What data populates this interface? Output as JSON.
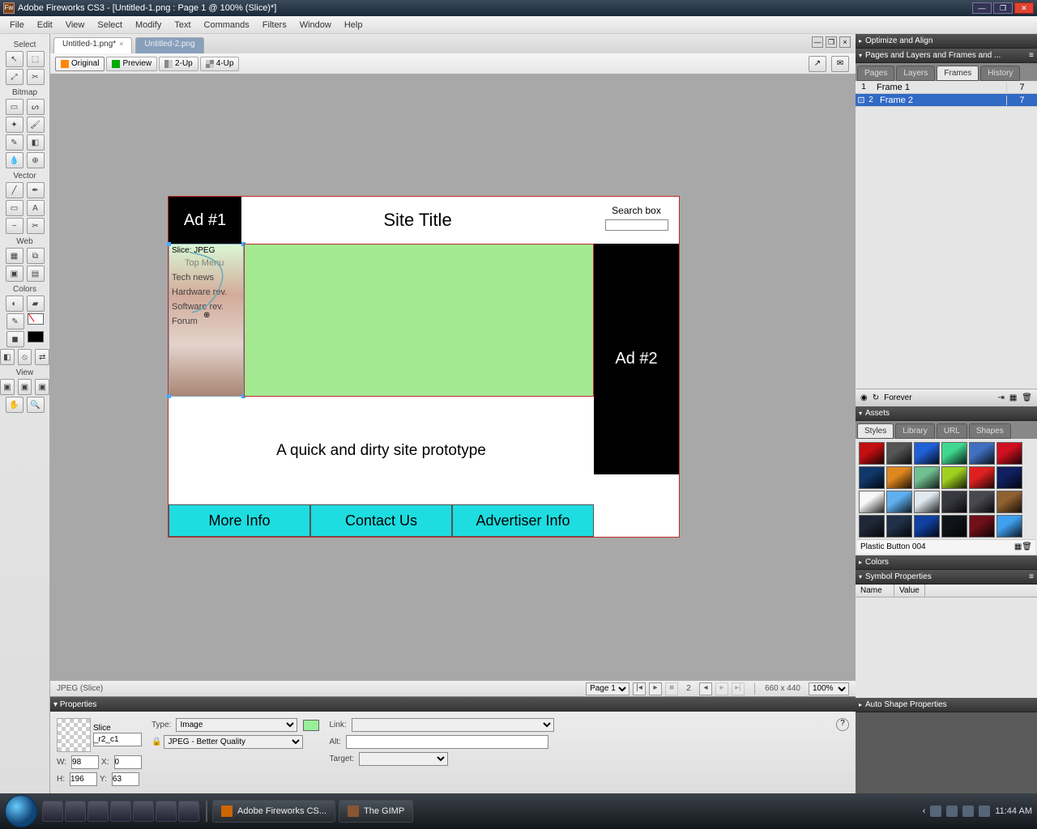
{
  "title": "Adobe Fireworks CS3 - [Untitled-1.png : Page 1 @ 100% (Slice)*]",
  "menu": [
    "File",
    "Edit",
    "View",
    "Select",
    "Modify",
    "Text",
    "Commands",
    "Filters",
    "Window",
    "Help"
  ],
  "toolbox": {
    "select": "Select",
    "bitmap": "Bitmap",
    "vector": "Vector",
    "web": "Web",
    "colors": "Colors",
    "view": "View"
  },
  "tabs": {
    "active": "Untitled-1.png*",
    "inactive": "Untitled-2.png"
  },
  "viewbar": {
    "original": "Original",
    "preview": "Preview",
    "two_up": "2-Up",
    "four_up": "4-Up"
  },
  "prototype": {
    "ad1": "Ad #1",
    "site_title": "Site Title",
    "search_label": "Search box",
    "slice_label": "Slice: JPEG",
    "top_menu": "Top Menu",
    "items": [
      "Tech news",
      "Hardware rev.",
      "Software rev.",
      "Forum"
    ],
    "ad2": "Ad #2",
    "body_text": "A quick and dirty site prototype",
    "footer": [
      "More Info",
      "Contact Us",
      "Advertiser Info"
    ]
  },
  "status": {
    "left": "JPEG (Slice)",
    "page": "Page 1",
    "frame_num": "2",
    "dims": "660 x 440",
    "zoom": "100%"
  },
  "panels": {
    "optimize": "Optimize and Align",
    "pages_layers": "Pages and Layers and Frames and ...",
    "tabs": [
      "Pages",
      "Layers",
      "Frames",
      "History"
    ],
    "frames": [
      {
        "num": "1",
        "name": "Frame 1",
        "dur": "7"
      },
      {
        "num": "2",
        "name": "Frame 2",
        "dur": "7"
      }
    ],
    "forever": "Forever",
    "assets": "Assets",
    "asset_tabs": [
      "Styles",
      "Library",
      "URL",
      "Shapes"
    ],
    "style_name": "Plastic Button 004",
    "colors": "Colors",
    "symbol_props": "Symbol Properties",
    "sym_cols": [
      "Name",
      "Value"
    ],
    "auto_shape": "Auto Shape Properties"
  },
  "swatches": [
    "#c41010",
    "#555",
    "#2060d8",
    "#40d890",
    "#4070c0",
    "#d01020",
    "#103868",
    "#e08820",
    "#70c090",
    "#a0d020",
    "#e02020",
    "#102060",
    "#f8f8f8",
    "#60b0f0",
    "#e0e8f0",
    "#383840",
    "#484850",
    "#906030",
    "#202838",
    "#203048",
    "#1040a0",
    "#101418",
    "#701018",
    "#40a0f0"
  ],
  "properties": {
    "title": "Properties",
    "slice_label": "Slice",
    "name": "_r2_c1",
    "type_label": "Type:",
    "type": "Image",
    "export": "JPEG - Better Quality",
    "link_label": "Link:",
    "alt_label": "Alt:",
    "target_label": "Target:",
    "w_label": "W:",
    "w": "98",
    "h_label": "H:",
    "h": "196",
    "x_label": "X:",
    "x": "0",
    "y_label": "Y:",
    "y": "63"
  },
  "taskbar": {
    "apps": [
      {
        "name": "Adobe Fireworks CS..."
      },
      {
        "name": "The GIMP"
      }
    ],
    "time": "11:44 AM"
  }
}
